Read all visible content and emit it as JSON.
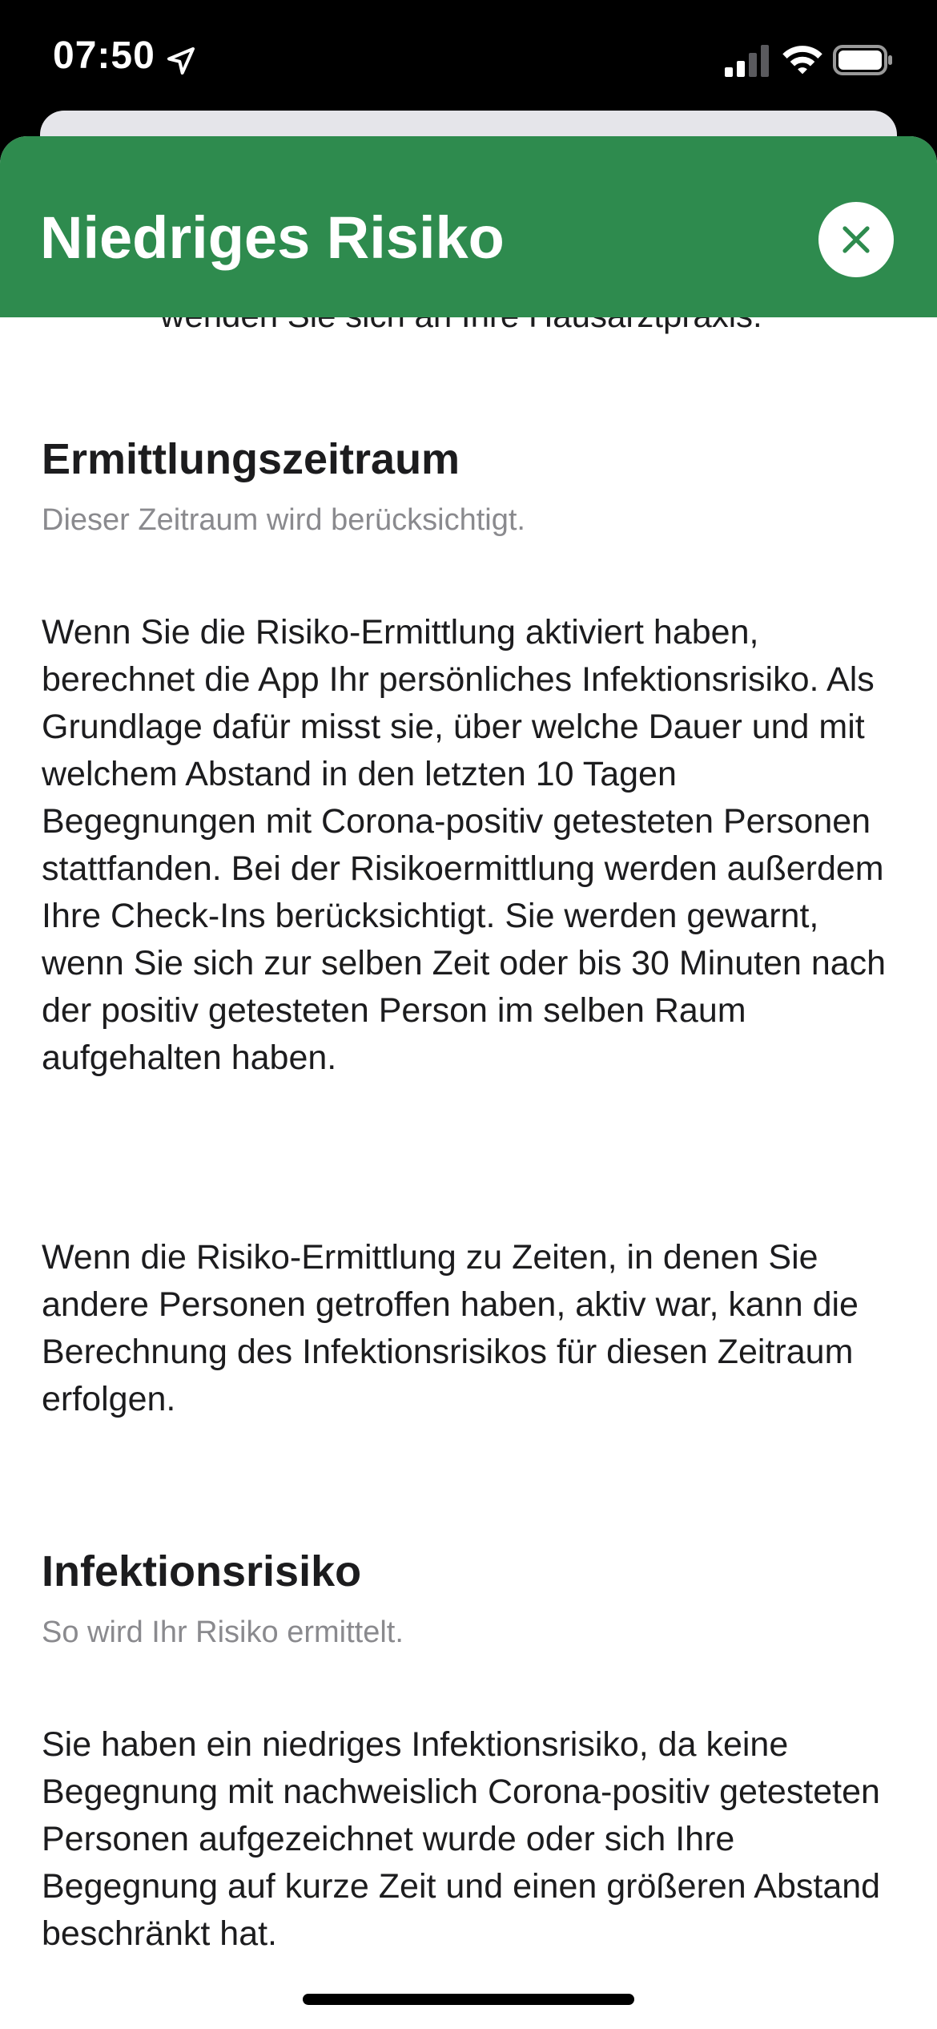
{
  "status_bar": {
    "time": "07:50",
    "icons": [
      "location-arrow-icon",
      "cellular-signal-icon",
      "wifi-icon",
      "battery-icon"
    ]
  },
  "header": {
    "title": "Niedriges Risiko",
    "background_color": "#2e8b4e",
    "close_icon": "close-icon"
  },
  "content": {
    "partial_line": "wenden Sie sich an Ihre Hausarztpraxis.",
    "sections": [
      {
        "title": "Ermittlungszeitraum",
        "subtitle": "Dieser Zeitraum wird berücksichtigt.",
        "paragraphs": [
          "Wenn Sie die Risiko-Ermittlung aktiviert haben, berechnet die App Ihr persönliches Infektionsrisiko. Als Grundlage dafür misst sie, über welche Dauer und mit welchem Abstand in den letzten 10 Tagen Begegnungen mit Corona-positiv getesteten Personen stattfanden. Bei der Risikoermittlung werden außerdem Ihre Check-Ins berücksichtigt. Sie werden gewarnt, wenn Sie sich zur selben Zeit oder bis 30 Minuten nach der positiv getesteten Person im selben Raum aufgehalten haben.",
          "Wenn die Risiko-Ermittlung zu Zeiten, in denen Sie andere Personen getroffen haben, aktiv war, kann die Berechnung des Infektionsrisikos für diesen Zeitraum erfolgen."
        ]
      },
      {
        "title": "Infektionsrisiko",
        "subtitle": "So wird Ihr Risiko ermittelt.",
        "paragraphs": [
          "Sie haben ein niedriges Infektionsrisiko, da keine Begegnung mit nachweislich Corona-positiv getesteten Personen aufgezeichnet wurde oder sich Ihre Begegnung auf kurze Zeit und einen größeren Abstand beschränkt hat."
        ]
      }
    ]
  }
}
